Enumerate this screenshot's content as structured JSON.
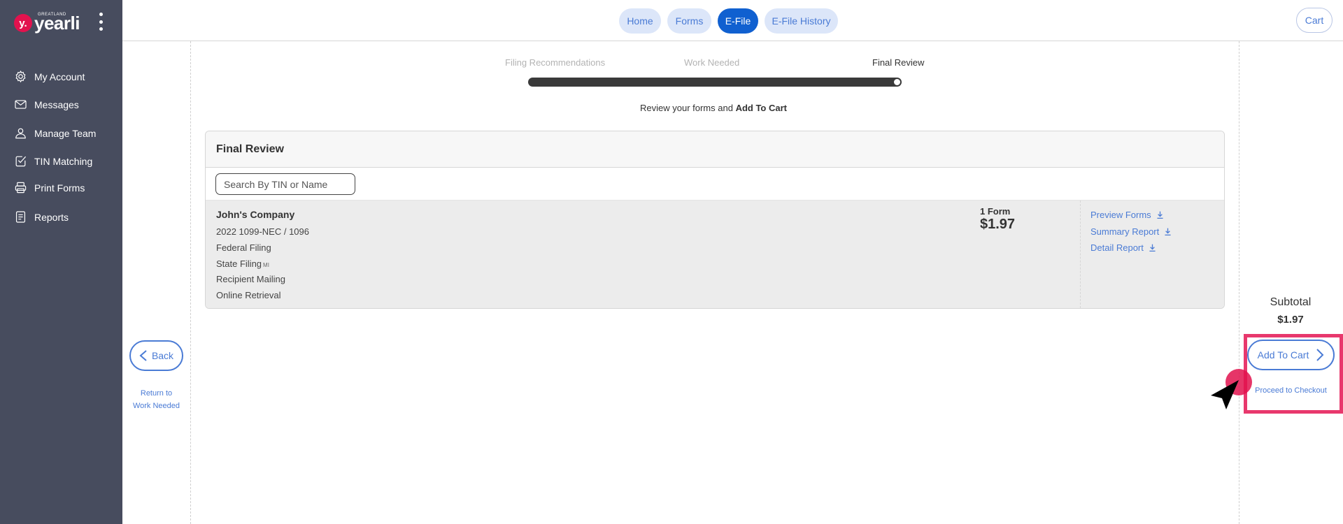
{
  "brand": {
    "small_text": "GREATLAND",
    "badge": "y.",
    "name": "yearli"
  },
  "sidebar": {
    "items": [
      {
        "label": "My Account",
        "icon": "gear-icon"
      },
      {
        "label": "Messages",
        "icon": "envelope-icon"
      },
      {
        "label": "Manage Team",
        "icon": "person-icon"
      },
      {
        "label": "TIN Matching",
        "icon": "check-square-icon"
      },
      {
        "label": "Print Forms",
        "icon": "printer-icon"
      },
      {
        "label": "Reports",
        "icon": "document-icon"
      }
    ]
  },
  "topnav": {
    "tabs": [
      {
        "label": "Home",
        "active": false
      },
      {
        "label": "Forms",
        "active": false
      },
      {
        "label": "E-File",
        "active": true
      },
      {
        "label": "E-File History",
        "active": false
      }
    ],
    "cart_label": "Cart"
  },
  "progress": {
    "steps": [
      "Filing Recommendations",
      "Work Needed",
      "Final Review"
    ],
    "current_step": 3
  },
  "instruction": {
    "prefix": "Review your forms and ",
    "bold": "Add To Cart"
  },
  "final_review": {
    "title": "Final Review",
    "search_placeholder": "Search By TIN or Name",
    "entry": {
      "company": "John's Company",
      "form_type": "2022 1099-NEC / 1096",
      "federal": "Federal Filing",
      "state": "State Filing",
      "state_code": "MI",
      "mailing": "Recipient Mailing",
      "retrieval": "Online Retrieval",
      "form_count": "1 Form",
      "price": "$1.97",
      "links": [
        "Preview Forms",
        "Summary Report",
        "Detail Report"
      ]
    }
  },
  "back": {
    "label": "Back",
    "note_line1": "Return to",
    "note_line2": "Work Needed"
  },
  "summary": {
    "subtotal_label": "Subtotal",
    "subtotal_value": "$1.97",
    "add_to_cart_label": "Add To Cart",
    "checkout_note": "Proceed to Checkout"
  },
  "colors": {
    "sidebar_bg": "#474c5e",
    "accent_blue": "#4a7bd5",
    "active_tab": "#1060d0",
    "highlight": "#e8386d",
    "brand_red": "#e2124e"
  }
}
